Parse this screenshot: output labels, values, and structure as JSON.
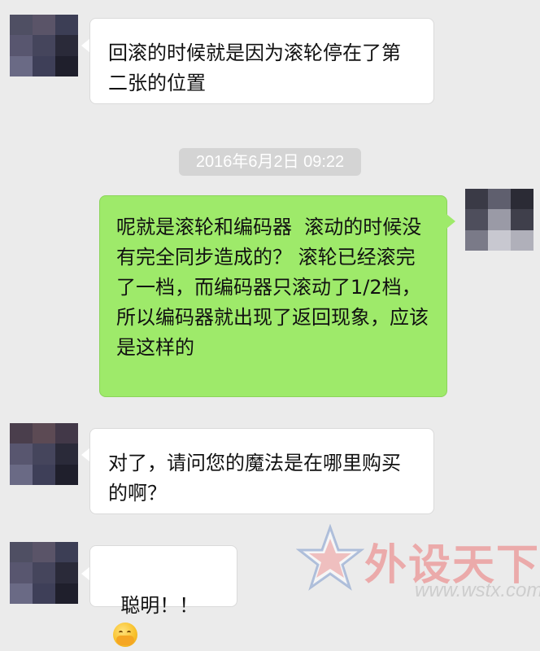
{
  "chat": {
    "timestamp": "2016年6月2日 09:22",
    "messages": [
      {
        "sender": "other",
        "text": "回滚的时候就是因为滚轮停在了第二张的位置"
      },
      {
        "sender": "self",
        "text": "呢就是滚轮和编码器  滚动的时候没有完全同步造成的？ 滚轮已经滚完了一档，而编码器只滚动了1/2档，所以编码器就出现了返回现象，应该是这样的"
      },
      {
        "sender": "other",
        "text": "对了，请问您的魔法是在哪里购买的啊？"
      },
      {
        "sender": "other",
        "text": "聪明！！",
        "emoji": "hand-over-mouth-emoji"
      }
    ]
  },
  "watermark": {
    "title": "外设天下",
    "url": "www.wstx.com"
  },
  "colors": {
    "background": "#ebebeb",
    "incoming_bubble": "#ffffff",
    "outgoing_bubble": "#9eea6a",
    "timestamp_bg": "#d4d4d4"
  }
}
